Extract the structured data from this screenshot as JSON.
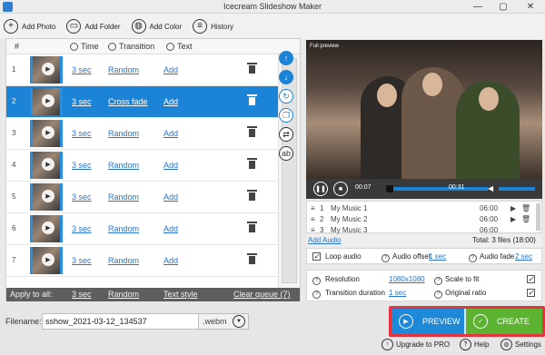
{
  "window": {
    "title": "Icecream Slideshow Maker",
    "minimize_icon": "—",
    "maximize_icon": "▢",
    "close_icon": "✕"
  },
  "toolbar": {
    "add_photo": "Add Photo",
    "add_folder": "Add Folder",
    "add_color": "Add Color",
    "history": "History"
  },
  "list": {
    "header": {
      "num": "#",
      "time": "Time",
      "transition": "Transition",
      "text": "Text"
    },
    "rows": [
      {
        "num": "1",
        "time": "3 sec",
        "transition": "Random",
        "text": "Add"
      },
      {
        "num": "2",
        "time": "3 sec",
        "transition": "Cross fade",
        "text": "Add"
      },
      {
        "num": "3",
        "time": "3 sec",
        "transition": "Random",
        "text": "Add"
      },
      {
        "num": "4",
        "time": "3 sec",
        "transition": "Random",
        "text": "Add"
      },
      {
        "num": "5",
        "time": "3 sec",
        "transition": "Random",
        "text": "Add"
      },
      {
        "num": "6",
        "time": "3 sec",
        "transition": "Random",
        "text": "Add"
      },
      {
        "num": "7",
        "time": "3 sec",
        "transition": "Random",
        "text": "Add"
      }
    ],
    "apply_all": {
      "label": "Apply to all:",
      "time": "3 sec",
      "transition": "Random",
      "text_style": "Text style",
      "clear_queue": "Clear queue (7)"
    }
  },
  "preview": {
    "label": "Full preview",
    "time_current": "00:07",
    "time_total": "00:31"
  },
  "music": {
    "tracks": [
      {
        "num": "1",
        "name": "My Music 1",
        "duration": "06:00"
      },
      {
        "num": "2",
        "name": "My Music 2",
        "duration": "06:00"
      },
      {
        "num": "3",
        "name": "My Music 3",
        "duration": "06:00"
      }
    ],
    "add_audio": "Add Audio",
    "total": "Total: 3 files (18:00)"
  },
  "audio_options": {
    "loop": "Loop audio",
    "offset_label": "Audio offset",
    "offset_value": "1 sec",
    "fade_label": "Audio fade",
    "fade_value": "2 sec"
  },
  "settings": {
    "resolution_label": "Resolution",
    "resolution_value": "1080x1080",
    "scale_label": "Scale to fit",
    "transition_duration_label": "Transition duration",
    "transition_duration_value": "1 sec",
    "original_ratio_label": "Original ratio"
  },
  "bottom": {
    "filename_label": "Filename:",
    "filename_value": "sshow_2021-03-12_134537",
    "extension": ".webm",
    "preview_button": "PREVIEW",
    "create_button": "CREATE",
    "upgrade": "Upgrade to PRO",
    "help": "Help",
    "settings": "Settings"
  },
  "colors": {
    "accent_blue": "#1b84d6",
    "create_green": "#5cb331",
    "highlight_red": "#e8323e"
  }
}
